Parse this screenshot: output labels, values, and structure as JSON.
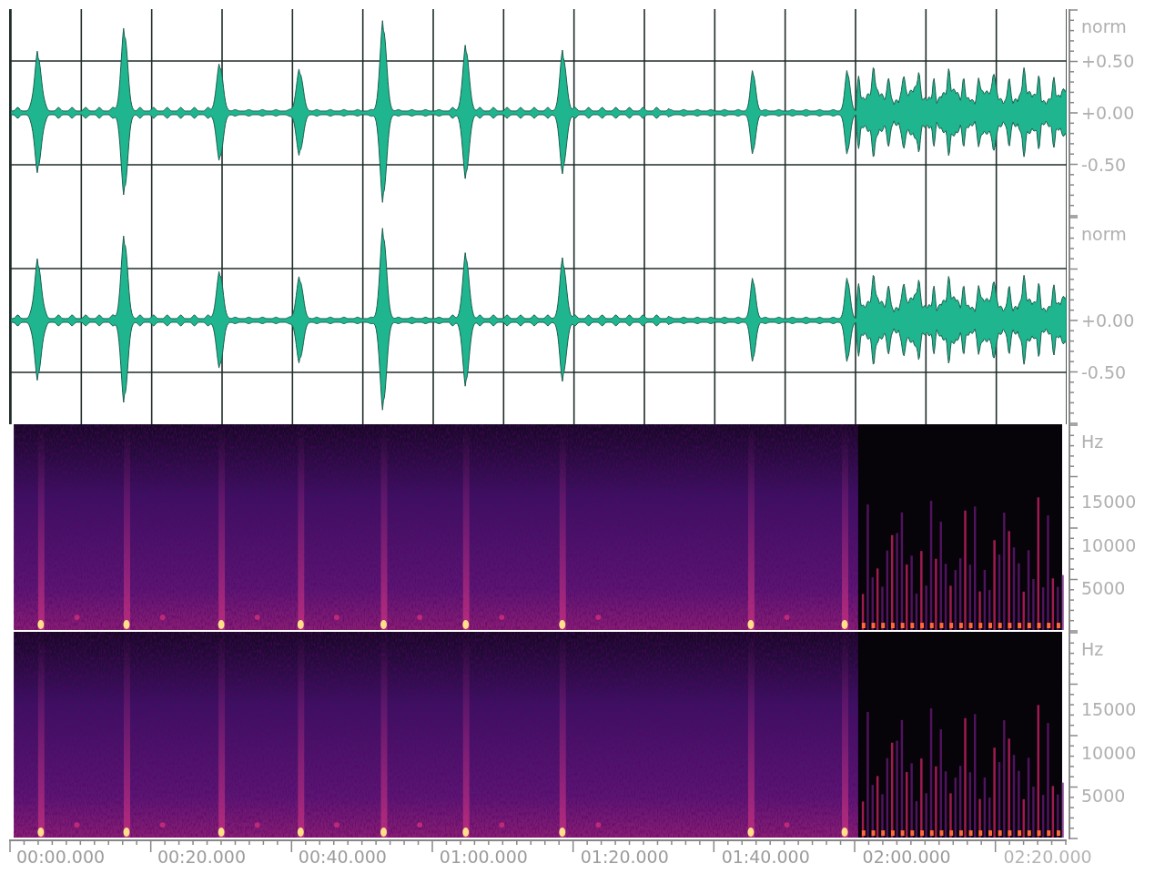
{
  "tracks": [
    {
      "kind": "waveform",
      "label": "norm",
      "ticks": {
        "upper": "+0.50",
        "center": "+0.00",
        "lower": "-0.50"
      }
    },
    {
      "kind": "waveform",
      "label": "norm",
      "ticks": {
        "center": "+0.00",
        "lower": "-0.50"
      }
    },
    {
      "kind": "spectrogram",
      "label": "Hz",
      "ticks": {
        "high": "15000",
        "mid": "10000",
        "low": "5000"
      }
    },
    {
      "kind": "spectrogram",
      "label": "Hz",
      "ticks": {
        "high": "15000",
        "mid": "10000",
        "low": "5000"
      }
    }
  ],
  "time_axis": [
    {
      "label": "00:00.000",
      "faded": false
    },
    {
      "label": "00:20.000",
      "faded": false
    },
    {
      "label": "00:40.000",
      "faded": false
    },
    {
      "label": "01:00.000",
      "faded": false
    },
    {
      "label": "01:20.000",
      "faded": false
    },
    {
      "label": "01:40.000",
      "faded": false
    },
    {
      "label": "02:00.000",
      "faded": false
    },
    {
      "label": "02:20.000",
      "faded": true
    }
  ]
}
